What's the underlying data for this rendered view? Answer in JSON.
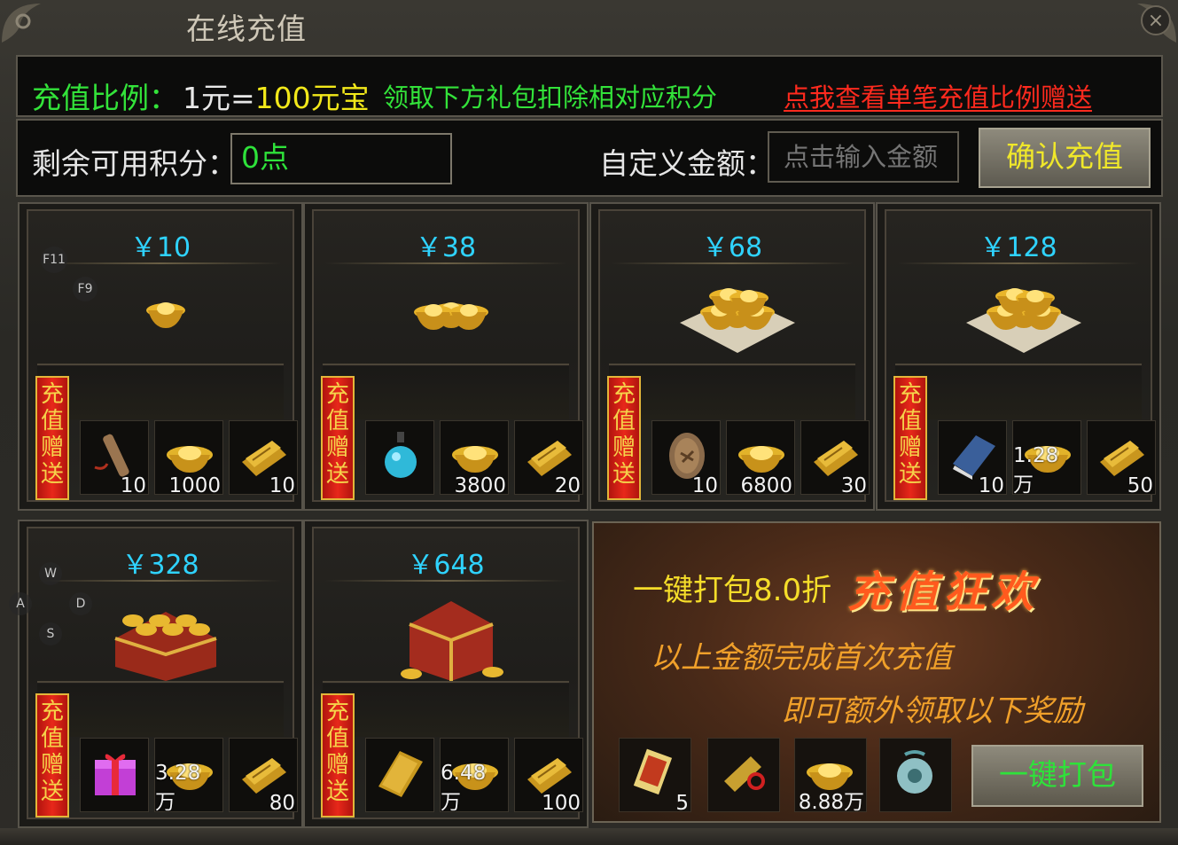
{
  "window": {
    "title": "在线充值",
    "close_label": "×"
  },
  "rate": {
    "label": "充值比例：",
    "value_prefix": "1元=",
    "value_gold": "100元宝",
    "hint": "领取下方礼包扣除相对应积分",
    "link": "点我查看单笔充值比例赠送"
  },
  "points": {
    "label": "剩余可用积分：",
    "value": "0点"
  },
  "custom": {
    "label": "自定义金额：",
    "placeholder": "点击输入金额"
  },
  "confirm_label": "确认充值",
  "ribbon_chars": [
    "充",
    "值",
    "赠",
    "送"
  ],
  "overlay": {
    "f11": "F11",
    "f9": "F9",
    "w": "W",
    "a": "A",
    "s": "S",
    "d": "D"
  },
  "packages": [
    {
      "price": "￥10",
      "rewards": [
        {
          "icon": "scroll-icon",
          "count": "10"
        },
        {
          "icon": "gold-ingot-icon",
          "count": "1000"
        },
        {
          "icon": "paper-bundle-icon",
          "count": "10"
        }
      ]
    },
    {
      "price": "￥38",
      "rewards": [
        {
          "icon": "potion-icon",
          "count": ""
        },
        {
          "icon": "gold-ingot-icon",
          "count": "3800"
        },
        {
          "icon": "paper-bundle-icon",
          "count": "20"
        }
      ]
    },
    {
      "price": "￥68",
      "rewards": [
        {
          "icon": "token-icon",
          "count": "10"
        },
        {
          "icon": "gold-ingot-icon",
          "count": "6800"
        },
        {
          "icon": "paper-bundle-icon",
          "count": "30"
        }
      ]
    },
    {
      "price": "￥128",
      "rewards": [
        {
          "icon": "skill-book-icon",
          "count": "10"
        },
        {
          "icon": "gold-ingot-icon",
          "count": "1.28万"
        },
        {
          "icon": "paper-bundle-icon",
          "count": "50"
        }
      ]
    },
    {
      "price": "￥328",
      "rewards": [
        {
          "icon": "gift-box-icon",
          "count": ""
        },
        {
          "icon": "gold-ingot-icon",
          "count": "3.28万"
        },
        {
          "icon": "paper-bundle-icon",
          "count": "80"
        }
      ]
    },
    {
      "price": "￥648",
      "rewards": [
        {
          "icon": "book-icon",
          "count": ""
        },
        {
          "icon": "gold-ingot-icon",
          "count": "6.48万"
        },
        {
          "icon": "paper-bundle-icon",
          "count": "100"
        }
      ]
    }
  ],
  "promo": {
    "line1": "一键打包8.0折",
    "big": "充值狂欢",
    "line2": "以上金额完成首次充值",
    "line3": "即可额外领取以下奖励",
    "rewards": [
      {
        "icon": "card-icon",
        "count": "5"
      },
      {
        "icon": "amulet-icon",
        "count": ""
      },
      {
        "icon": "gold-ingot-icon",
        "count": "8.88万"
      },
      {
        "icon": "jade-pendant-icon",
        "count": ""
      }
    ],
    "button": "一键打包"
  }
}
